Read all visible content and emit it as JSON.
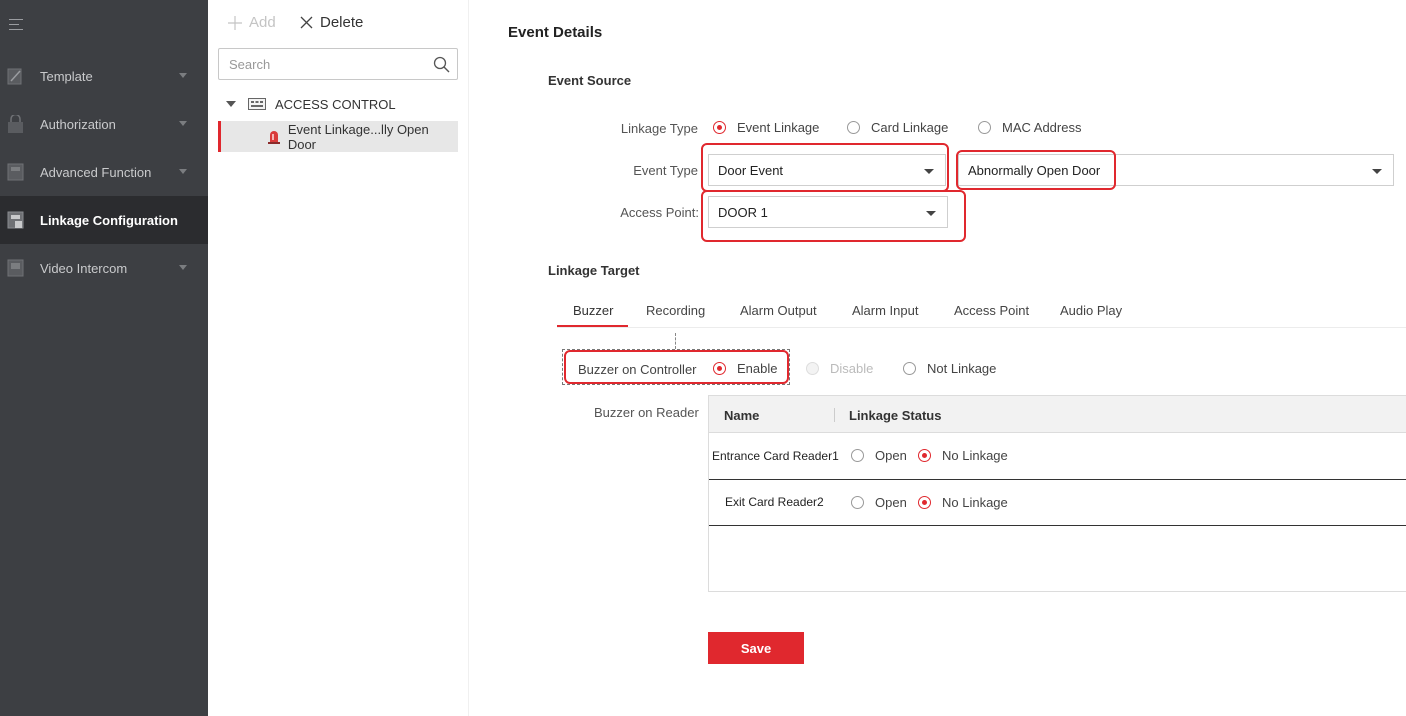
{
  "sidebar": {
    "items": [
      {
        "label": "Template",
        "icon": "template-icon"
      },
      {
        "label": "Authorization",
        "icon": "lock-icon"
      },
      {
        "label": "Advanced Function",
        "icon": "advanced-icon"
      },
      {
        "label": "Linkage Configuration",
        "icon": "linkage-icon",
        "active": true
      },
      {
        "label": "Video Intercom",
        "icon": "intercom-icon"
      }
    ]
  },
  "toolbar": {
    "add_label": "Add",
    "delete_label": "Delete"
  },
  "search": {
    "placeholder": "Search"
  },
  "tree": {
    "root_label": "ACCESS CONTROL",
    "child_label": "Event Linkage...lly Open Door"
  },
  "event_details": {
    "title": "Event Details",
    "event_source_heading": "Event Source",
    "linkage_type_label": "Linkage Type",
    "linkage_types": [
      "Event Linkage",
      "Card Linkage",
      "MAC Address"
    ],
    "event_type_label": "Event Type",
    "event_type_value": "Door Event",
    "event_subtype_value": "Abnormally Open Door",
    "access_point_label": "Access Point:",
    "access_point_value": "DOOR 1"
  },
  "linkage_target": {
    "heading": "Linkage Target",
    "tabs": [
      "Buzzer",
      "Recording",
      "Alarm Output",
      "Alarm Input",
      "Access Point",
      "Audio Play"
    ],
    "buzzer_controller_label": "Buzzer on Controller",
    "controller_options": [
      "Enable",
      "Disable",
      "Not Linkage"
    ],
    "buzzer_reader_label": "Buzzer on Reader",
    "table_headers": [
      "Name",
      "Linkage Status"
    ],
    "rows": [
      {
        "name": "Entrance Card Reader1",
        "open": "Open",
        "no_linkage": "No Linkage"
      },
      {
        "name": "Exit Card Reader2",
        "open": "Open",
        "no_linkage": "No Linkage"
      }
    ],
    "save_label": "Save"
  },
  "colors": {
    "accent": "#e0282e",
    "sidebar_bg": "#3d3f43",
    "sidebar_active": "#2b2c2f"
  }
}
